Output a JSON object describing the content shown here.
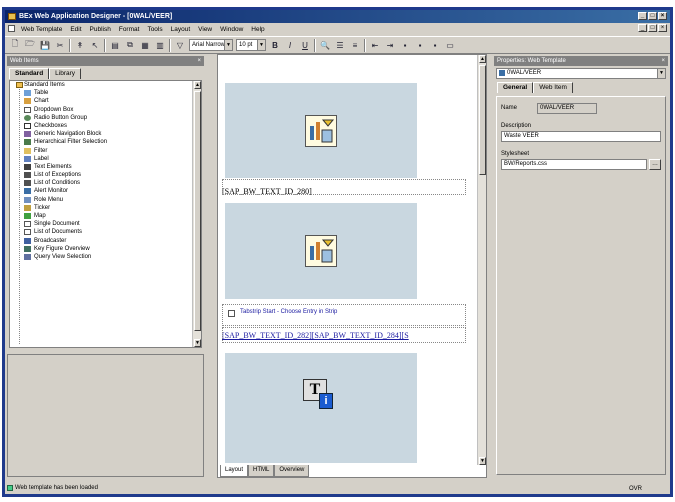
{
  "window": {
    "title": "BEx Web Application Designer - [0WAL/VEER]"
  },
  "menu": [
    "Web Template",
    "Edit",
    "Publish",
    "Format",
    "Tools",
    "Layout",
    "View",
    "Window",
    "Help"
  ],
  "toolbar": {
    "font_name": "Arial Narrow",
    "font_size": "10 pt"
  },
  "web_items_pane": {
    "title": "Web Items",
    "tabs": [
      "Standard",
      "Library"
    ],
    "root": "Standard Items",
    "items": [
      "Table",
      "Chart",
      "Dropdown Box",
      "Radio Button Group",
      "Checkboxes",
      "Generic Navigation Block",
      "Hierarchical Filter Selection",
      "Filter",
      "Label",
      "Text Elements",
      "List of Exceptions",
      "List of Conditions",
      "Alert Monitor",
      "Role Menu",
      "Ticker",
      "Map",
      "Single Document",
      "List of Documents",
      "Broadcaster",
      "Key Figure Overview",
      "Query View Selection"
    ]
  },
  "center": {
    "text_id_1": "[SAP_BW_TEXT_ID_280]",
    "tabstrip_label": "Tabstrip Start - Choose Entry in Strip",
    "text_id_2": "[SAP_BW_TEXT_ID_282][SAP_BW_TEXT_ID_284][S",
    "bottom_tabs": [
      "Layout",
      "HTML",
      "Overview"
    ]
  },
  "properties": {
    "title": "Properties: Web Template",
    "selected": "0WAL/VEER",
    "tabs": [
      "General",
      "Web Item"
    ],
    "name_label": "Name",
    "name_value": "0WAL/VEER",
    "description_label": "Description",
    "description_value": "Waste VEER",
    "stylesheet_label": "Stylesheet",
    "stylesheet_value": "BW/Reports.css"
  },
  "status": {
    "text": "Web template has been loaded",
    "right": "OVR"
  }
}
